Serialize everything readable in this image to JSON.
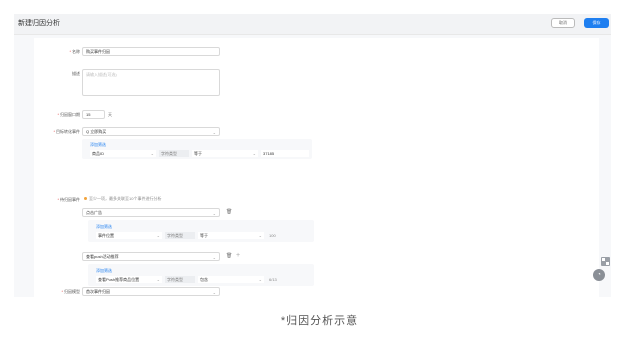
{
  "header": {
    "title": "新建归因分析",
    "cancel_label": "取消",
    "save_label": "保存"
  },
  "form": {
    "name": {
      "label": "名称",
      "value": "购买事件归因"
    },
    "description": {
      "label": "描述",
      "placeholder": "请输入描述(可选)"
    },
    "window": {
      "label": "归因窗口期",
      "value": "15",
      "unit": "天"
    },
    "target_event": {
      "label": "目标转化事件",
      "select_value": "Q 立即购买",
      "filter_link": "添加筛选",
      "filter_field": "商品ID",
      "filter_type": "字符类型",
      "filter_operator": "等于",
      "filter_value": "37185"
    },
    "touch_events": {
      "label": "待归因事件",
      "hint": "至少一项，最多关联至10个事件进行分析",
      "event1": {
        "select_value": "点击广告",
        "filter_link": "添加筛选",
        "filter_field": "事件位置",
        "filter_type": "字符类型",
        "filter_operator": "等于",
        "filter_value": "100"
      },
      "event2": {
        "select_value": "查看push活动推荐",
        "filter_link": "添加筛选",
        "filter_field": "查看Push推荐商品位置",
        "filter_type": "字符类型",
        "filter_operator": "包含",
        "filter_value": "6/13"
      }
    },
    "model": {
      "label": "归因模型",
      "value": "首次事件归因"
    }
  },
  "caption": "*归因分析示意",
  "colors": {
    "primary": "#1f7ff0",
    "required": "#e34d4d",
    "warning": "#f2a33c"
  }
}
